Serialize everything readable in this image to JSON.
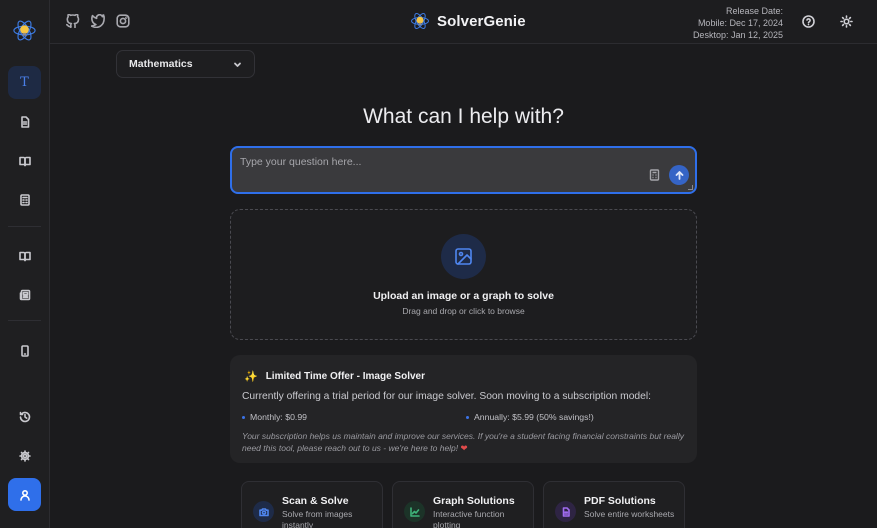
{
  "app": {
    "name": "SolverGenie"
  },
  "header": {
    "release_label": "Release Date:",
    "mobile_release": "Mobile: Dec 17, 2024",
    "desktop_release": "Desktop: Jan 12, 2025",
    "icons": [
      "github-icon",
      "twitter-icon",
      "instagram-icon",
      "help-icon",
      "theme-sun-icon"
    ]
  },
  "sidebar": {
    "items": [
      {
        "icon": "text-icon",
        "active": true
      },
      {
        "icon": "document-icon"
      },
      {
        "icon": "book-open-icon"
      },
      {
        "icon": "calculator-icon"
      },
      {
        "icon": "book-icon"
      },
      {
        "icon": "newspaper-icon"
      },
      {
        "icon": "mobile-icon"
      },
      {
        "icon": "history-icon"
      },
      {
        "icon": "settings-icon"
      },
      {
        "icon": "user-icon"
      }
    ]
  },
  "subject_select": {
    "value": "Mathematics"
  },
  "hero": {
    "title": "What can I help with?"
  },
  "question": {
    "placeholder": "Type your question here...",
    "value": ""
  },
  "upload": {
    "title": "Upload an image or a graph to solve",
    "subtitle": "Drag and drop or click to browse"
  },
  "offer": {
    "title": "Limited Time Offer - Image Solver",
    "description": "Currently offering a trial period for our image solver. Soon moving to a subscription model:",
    "monthly": "Monthly: $0.99",
    "annually": "Annually: $5.99 (50% savings!)",
    "note": "Your subscription helps us maintain and improve our services. If you're a student facing financial constraints but really need this tool, please reach out to us - we're here to help!"
  },
  "features": [
    {
      "title": "Scan & Solve",
      "desc": "Solve from images instantly",
      "icon": "camera-icon",
      "color": "#4f86f0"
    },
    {
      "title": "Graph Solutions",
      "desc": "Interactive function plotting",
      "icon": "chart-line-icon",
      "color": "#3fb37a"
    },
    {
      "title": "PDF Solutions",
      "desc": "Solve entire worksheets",
      "icon": "file-icon",
      "color": "#a06cf0"
    }
  ],
  "colors": {
    "accent": "#2f6fea",
    "background": "#1b1b1d"
  }
}
